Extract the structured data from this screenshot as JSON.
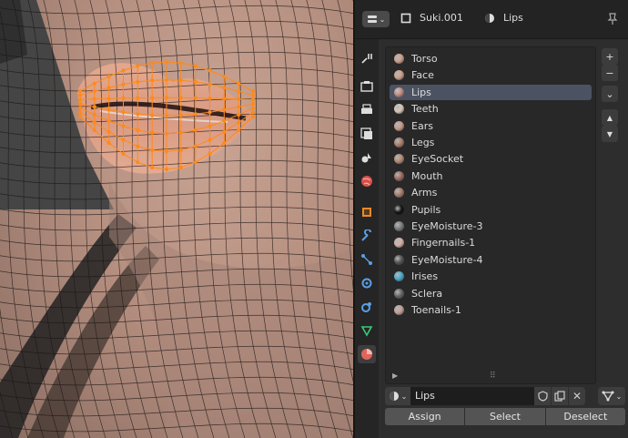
{
  "header": {
    "object_name": "Suki.001",
    "material_name": "Lips",
    "editor_type_icon": "properties-editor-icon",
    "pin_icon": "pin-icon"
  },
  "tabs": [
    {
      "name": "tool",
      "icon": "wrench-screwdriver-icon"
    },
    {
      "name": "render",
      "icon": "camera-back-icon"
    },
    {
      "name": "output",
      "icon": "printer-icon"
    },
    {
      "name": "view-layer",
      "icon": "image-stack-icon"
    },
    {
      "name": "scene",
      "icon": "scene-icon"
    },
    {
      "name": "world",
      "icon": "world-icon"
    },
    {
      "name": "object",
      "icon": "object-square-icon"
    },
    {
      "name": "modifiers",
      "icon": "wrench-icon"
    },
    {
      "name": "particles",
      "icon": "particles-icon"
    },
    {
      "name": "physics",
      "icon": "physics-icon"
    },
    {
      "name": "constraints",
      "icon": "constraint-icon"
    },
    {
      "name": "data",
      "icon": "mesh-data-icon"
    },
    {
      "name": "material",
      "icon": "material-icon"
    }
  ],
  "materials": [
    {
      "label": "Torso",
      "color": "#c9a08c"
    },
    {
      "label": "Face",
      "color": "#caa08b"
    },
    {
      "label": "Lips",
      "color": "#c08a7c"
    },
    {
      "label": "Teeth",
      "color": "#d8c8b8"
    },
    {
      "label": "Ears",
      "color": "#c49a86"
    },
    {
      "label": "Legs",
      "color": "#a87e6c"
    },
    {
      "label": "EyeSocket",
      "color": "#b28976"
    },
    {
      "label": "Mouth",
      "color": "#9c6a62"
    },
    {
      "label": "Arms",
      "color": "#a67c6a"
    },
    {
      "label": "Pupils",
      "color": "#111111"
    },
    {
      "label": "EyeMoisture-3",
      "color": "#7a7a7a"
    },
    {
      "label": "Fingernails-1",
      "color": "#d2b0a4"
    },
    {
      "label": "EyeMoisture-4",
      "color": "#555555"
    },
    {
      "label": "Irises",
      "color": "#4aa8c8"
    },
    {
      "label": "Sclera",
      "color": "#666666"
    },
    {
      "label": "Toenails-1",
      "color": "#bfa095"
    }
  ],
  "selected_material": "Lips",
  "list_side_buttons": [
    "+",
    "−",
    "⌄",
    "▲",
    "▼"
  ],
  "slot": {
    "material_name": "Lips"
  },
  "actions": {
    "assign": "Assign",
    "select": "Select",
    "deselect": "Deselect"
  },
  "colors": {
    "selection_orange": "#ff8a1a",
    "list_selected": "#4b5262",
    "active_tab_material": "#e0655a"
  }
}
